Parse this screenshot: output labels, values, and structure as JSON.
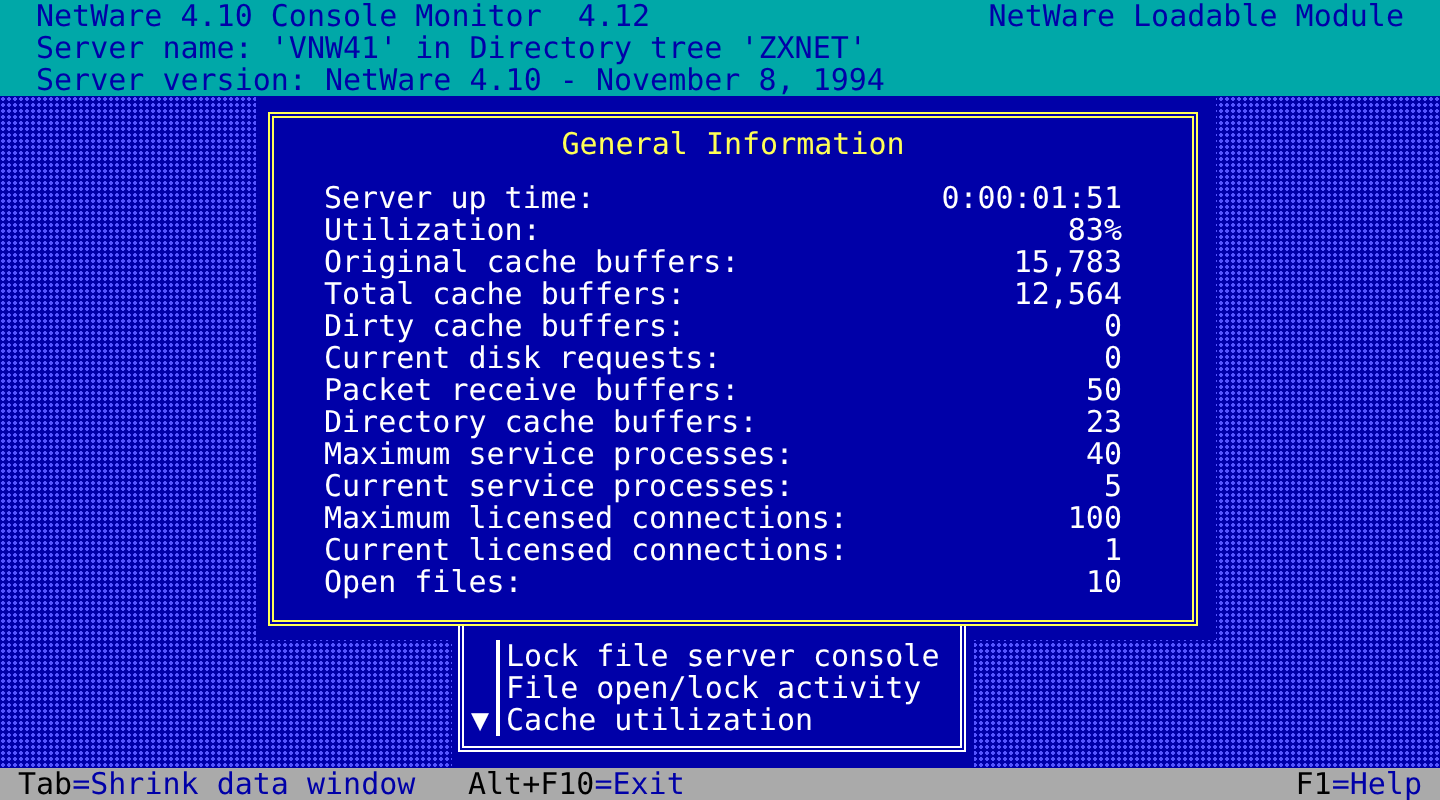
{
  "header": {
    "title": "NetWare 4.10 Console Monitor  4.12",
    "module": "NetWare Loadable Module",
    "lines": [
      "Server name: 'VNW41' in Directory tree 'ZXNET'",
      "Server version: NetWare 4.10 - November 8, 1994"
    ]
  },
  "info_window": {
    "title": "General Information",
    "rows": [
      {
        "label": "Server up time:",
        "value": "0:00:01:51"
      },
      {
        "label": "Utilization:",
        "value": "83%"
      },
      {
        "label": "Original cache buffers:",
        "value": "15,783"
      },
      {
        "label": "Total cache buffers:",
        "value": "12,564"
      },
      {
        "label": "Dirty cache buffers:",
        "value": "0"
      },
      {
        "label": "Current disk requests:",
        "value": "0"
      },
      {
        "label": "Packet receive buffers:",
        "value": "50"
      },
      {
        "label": "Directory cache buffers:",
        "value": "23"
      },
      {
        "label": "Maximum service processes:",
        "value": "40"
      },
      {
        "label": "Current service processes:",
        "value": "5"
      },
      {
        "label": "Maximum licensed connections:",
        "value": "100"
      },
      {
        "label": "Current licensed connections:",
        "value": "1"
      },
      {
        "label": "Open files:",
        "value": "10"
      }
    ]
  },
  "menu": {
    "items": [
      "Lock file server console",
      "File open/lock activity",
      "Cache utilization"
    ],
    "scroll_indicator": "▼"
  },
  "status_bar": [
    {
      "key": "Tab",
      "action": "=Shrink data window"
    },
    {
      "key": "Alt+F10",
      "action": "=Exit"
    },
    {
      "key": "F1",
      "action": "=Help"
    }
  ]
}
